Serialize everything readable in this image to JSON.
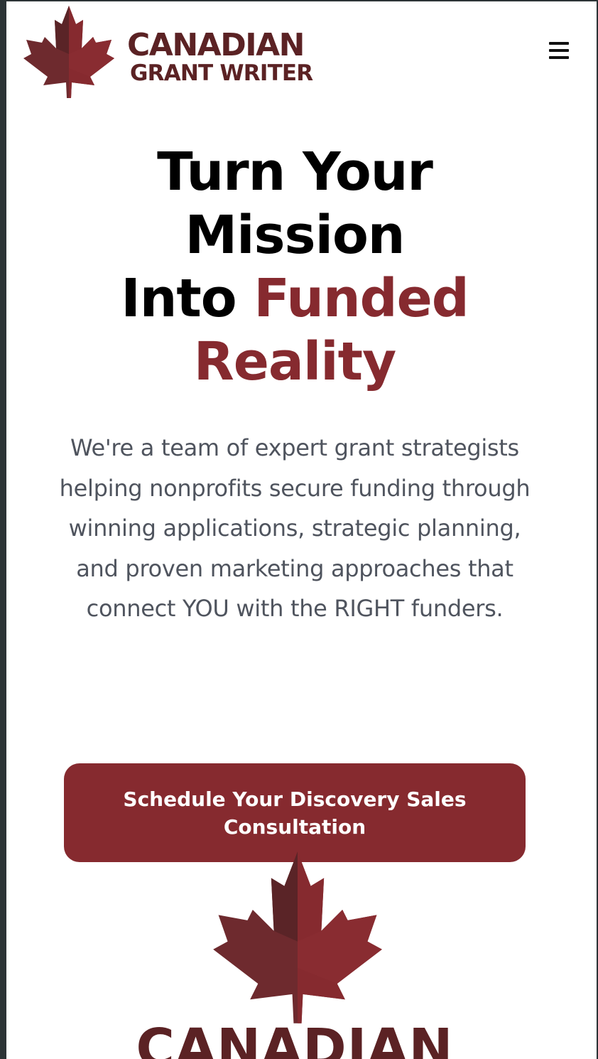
{
  "header": {
    "logo_line1": "CANADIAN",
    "logo_line2": "GRANT WRITER",
    "logo_icon": "maple-leaf-icon",
    "menu_icon": "hamburger-menu-icon"
  },
  "hero": {
    "title_line1": "Turn Your",
    "title_line2": "Mission",
    "title_line3_plain": "Into",
    "title_line3_accent": "Funded",
    "title_line4_accent": "Reality",
    "description": "We're a team of expert grant strategists helping nonprofits secure funding through winning applications, strategic planning, and proven marketing approaches that connect YOU with the RIGHT funders.",
    "cta_label": "Schedule Your Discovery Sales Consultation"
  },
  "footer_logo": {
    "text": "CANADIAN",
    "icon": "maple-leaf-icon"
  },
  "colors": {
    "brand": "#862a2f",
    "brand_dark": "#5b2224",
    "body_text": "#4f545e",
    "heading": "#000000"
  }
}
